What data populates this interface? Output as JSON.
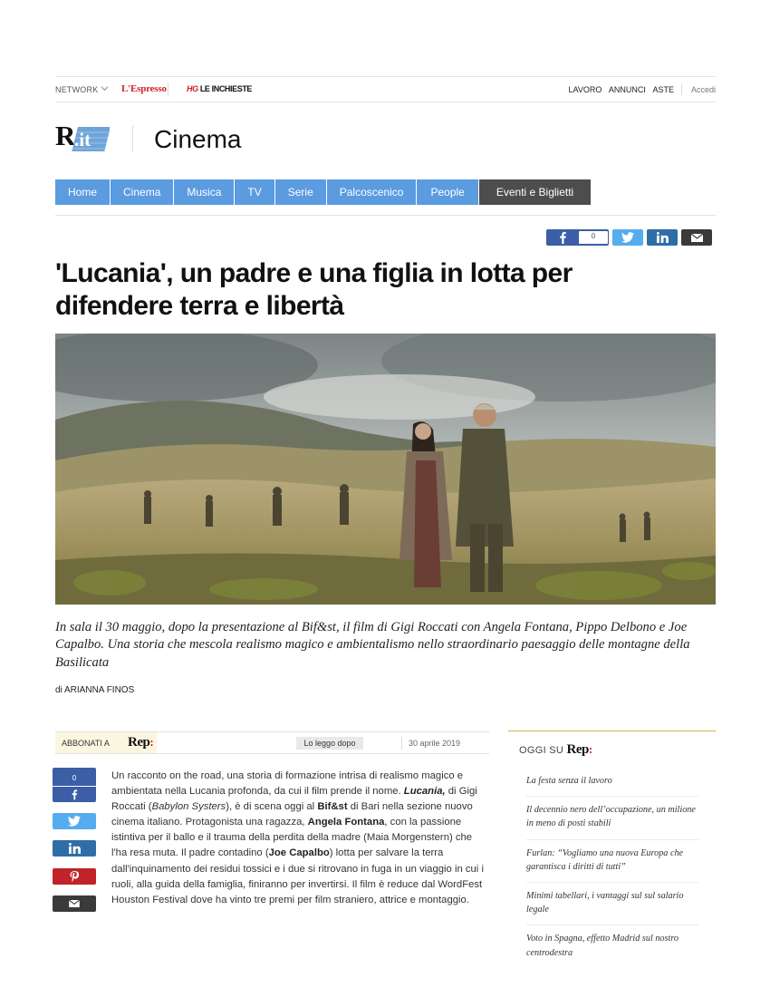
{
  "network_bar": {
    "network_label": "NETWORK",
    "brand1": "L'Espresso",
    "brand2_mark": "HG",
    "brand2": "LE INCHIESTE",
    "links": [
      "LAVORO",
      "ANNUNCI",
      "ASTE"
    ],
    "login": "Accedi"
  },
  "header": {
    "logo_text": "R.it",
    "section": "Cinema"
  },
  "nav": {
    "items": [
      "Home",
      "Cinema",
      "Musica",
      "TV",
      "Serie",
      "Palcoscenico",
      "People"
    ],
    "special": "Eventi e Biglietti"
  },
  "share": {
    "facebook_count": "0"
  },
  "article": {
    "title": "'Lucania', un padre e una figlia in lotta per difendere terra e libertà",
    "summary": "In sala il 30 maggio, dopo la presentazione al Bif&st, il film di Gigi Roccati con Angela Fontana, Pippo Delbono e Joe Capalbo. Una storia che mescola realismo magico e ambientalismo nello straordinario paesaggio delle montagne della Basilicata",
    "byline": "di ARIANNA FINOS",
    "date": "30 aprile 2019",
    "body": {
      "p1": "Un racconto on the road, una storia di formazione intrisa di realismo magico e ambientata nella Lucania profonda, da cui il film prende il nome. ",
      "b1": "Lucania,",
      "p2": " di Gigi Roccati (",
      "i1": "Babylon Systers",
      "p3": "), è di scena oggi al ",
      "b2": "Bif&st",
      "p4": " di Bari nella sezione nuovo cinema italiano. Protagonista una ragazza, ",
      "b3": "Angela Fontana",
      "p5": ", con la passione istintiva per il ballo e il trauma della perdita della madre (Maia Morgenstern) che l'ha resa muta. Il padre contadino (",
      "b4": "Joe Capalbo",
      "p6": ") lotta per salvare la terra dall'inquinamento dei residui tossici e i due si ritrovano in fuga in un viaggio in cui i ruoli, alla guida della famiglia, finiranno per invertirsi. Il film è reduce dal WordFest Houston Festival dove ha vinto tre premi per film straniero, attrice e montaggio."
    }
  },
  "abbonati": {
    "label": "ABBONATI A",
    "rep": "Rep",
    "rep_colon": ":",
    "later": "Lo leggo dopo"
  },
  "oggi": {
    "label": "OGGI SU",
    "rep": "Rep",
    "rep_colon": ":",
    "items": [
      "La festa senza il lavoro",
      "Il decennio nero dell’occupazione, un milione in meno di posti stabili",
      "Furlan: “Vogliamo una nuova Europa che garantisca i diritti di tutti”",
      "Minimi tabellari, i vantaggi sul sul salario legale",
      "Voto in Spagna, effetto Madrid sul nostro centrodestra"
    ]
  },
  "colors": {
    "nav_blue": "#5b9be0",
    "nav_dark": "#4d4d4d",
    "facebook": "#3b5ea7",
    "twitter": "#55acee",
    "linkedin": "#2f6da7",
    "pinterest": "#c1232b",
    "mail": "#3a3a3a",
    "brand_red": "#d0202a"
  }
}
